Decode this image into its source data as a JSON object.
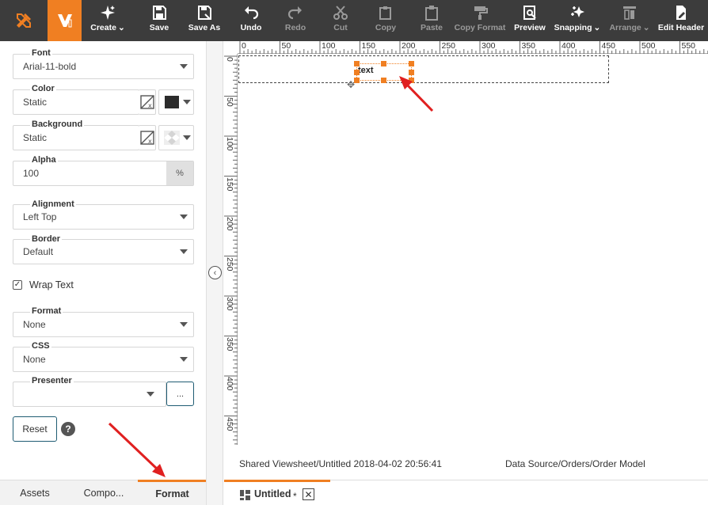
{
  "toolbar": {
    "buttons": [
      {
        "label": "Create",
        "dropdown": true,
        "icon": "sparkle-icon"
      },
      {
        "label": "Save",
        "icon": "save-icon"
      },
      {
        "label": "Save As",
        "icon": "save-as-icon"
      },
      {
        "label": "Undo",
        "icon": "undo-icon"
      },
      {
        "label": "Redo",
        "icon": "redo-icon",
        "disabled": true
      },
      {
        "label": "Cut",
        "icon": "cut-icon",
        "disabled": true
      },
      {
        "label": "Copy",
        "icon": "copy-icon",
        "disabled": true
      },
      {
        "label": "Paste",
        "icon": "paste-icon",
        "disabled": true
      },
      {
        "label": "Copy Format",
        "icon": "paint-roller-icon",
        "disabled": true
      },
      {
        "label": "Preview",
        "icon": "preview-icon"
      },
      {
        "label": "Snapping",
        "dropdown": true,
        "icon": "snapping-icon"
      },
      {
        "label": "Arrange",
        "dropdown": true,
        "icon": "arrange-icon",
        "disabled": true
      },
      {
        "label": "Edit Header",
        "icon": "edit-header-icon"
      }
    ]
  },
  "format_panel": {
    "font": {
      "label": "Font",
      "value": "Arial-11-bold"
    },
    "color": {
      "label": "Color",
      "value": "Static",
      "swatch": "#2b2b2b"
    },
    "background": {
      "label": "Background",
      "value": "Static"
    },
    "alpha": {
      "label": "Alpha",
      "value": "100",
      "unit": "%"
    },
    "alignment": {
      "label": "Alignment",
      "value": "Left Top"
    },
    "border": {
      "label": "Border",
      "value": "Default"
    },
    "wrap_text": {
      "label": "Wrap Text",
      "checked": true,
      "mark": "✓"
    },
    "format": {
      "label": "Format",
      "value": "None"
    },
    "css": {
      "label": "CSS",
      "value": "None"
    },
    "presenter": {
      "label": "Presenter",
      "value": "",
      "more_label": "..."
    },
    "reset_label": "Reset",
    "help_label": "?"
  },
  "bottom_tabs": [
    {
      "label": "Assets"
    },
    {
      "label": "Compo..."
    },
    {
      "label": "Format",
      "active": true
    }
  ],
  "canvas": {
    "h_ticks": [
      "0",
      "50",
      "100",
      "150",
      "200",
      "250",
      "300",
      "350",
      "400",
      "450",
      "500",
      "550"
    ],
    "v_ticks": [
      "0",
      "50",
      "100",
      "150",
      "200",
      "250",
      "300",
      "350",
      "400",
      "450"
    ],
    "text_component": "text"
  },
  "status": {
    "left": "Shared Viewsheet/Untitled 2018-04-02 20:56:41",
    "right": "Data Source/Orders/Order Model"
  },
  "doc_tab": {
    "label": "Untitled",
    "modified_mark": "*",
    "close": "✕"
  },
  "colors": {
    "accent": "#f07f22",
    "toolbar_bg": "#3c3c3c",
    "arrow": "#e02020"
  }
}
